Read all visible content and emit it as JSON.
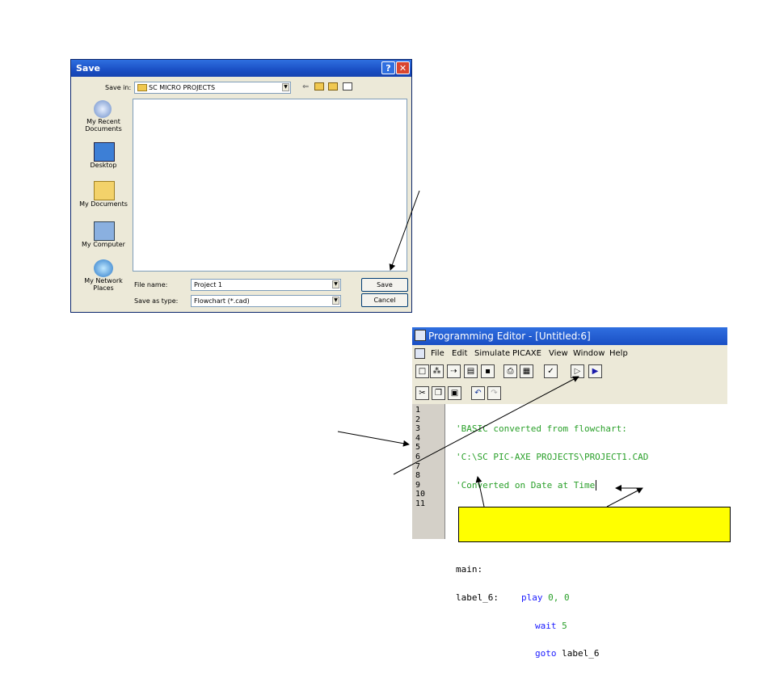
{
  "save_dialog": {
    "title": "Save",
    "help_btn": "?",
    "close_btn": "✕",
    "save_in_label": "Save in:",
    "save_in_value": "SC MICRO PROJECTS",
    "places": [
      {
        "label": "My Recent Documents",
        "icon": "recent-documents-icon"
      },
      {
        "label": "Desktop",
        "icon": "desktop-icon"
      },
      {
        "label": "My Documents",
        "icon": "my-documents-icon"
      },
      {
        "label": "My Computer",
        "icon": "my-computer-icon"
      },
      {
        "label": "My Network Places",
        "icon": "network-places-icon"
      }
    ],
    "file_name_label": "File name:",
    "file_name_value": "Project 1",
    "save_type_label": "Save as type:",
    "save_type_value": "Flowchart (*.cad)",
    "save_button": "Save",
    "cancel_button": "Cancel"
  },
  "editor": {
    "title": "Programming Editor  - [Untitled:6]",
    "menu": [
      "File",
      "Edit",
      "Simulate",
      "PICAXE",
      "View",
      "Window",
      "Help"
    ],
    "line_numbers": [
      "1",
      "2",
      "3",
      "4",
      "5",
      "6",
      "7",
      "8",
      "9",
      "10",
      "11"
    ],
    "code": {
      "l1": "'BASIC converted from flowchart:",
      "l2": "'C:\\SC PIC-AXE PROJECTS\\PROJECT1.CAD",
      "l3": "'Converted on Date at Time",
      "l6": "main:",
      "l7_label": "label_6:",
      "l7_cmd": "play",
      "l7_args": " 0, 0",
      "l8_cmd": "wait",
      "l8_args": " 5",
      "l9_cmd": "goto",
      "l9_args": " label_6"
    }
  }
}
